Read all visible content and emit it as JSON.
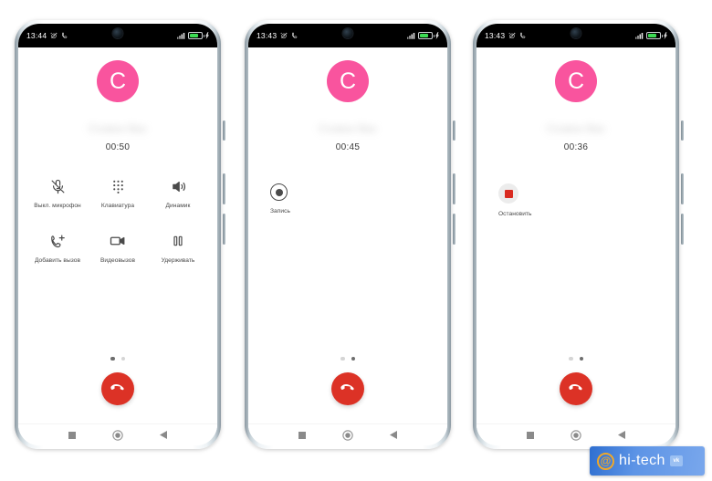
{
  "colors": {
    "avatar_pink": "#f9549e",
    "end_call_red": "#dc3226",
    "stop_square_red": "#d92b21",
    "battery_green": "#3ddc54",
    "watermark_blue": "#5d94e6",
    "watermark_gold": "#f0a829"
  },
  "watermark": {
    "at_symbol": "@",
    "brand": "hi-tech",
    "social_badge": "vk"
  },
  "navbar": {
    "recents_icon": "square-icon",
    "home_icon": "circle-icon",
    "back_icon": "triangle-back-icon"
  },
  "phones": [
    {
      "id": "phone-1",
      "status_bar": {
        "time": "13:44",
        "icons_left": [
          "alarm-off-icon",
          "phone-call-icon"
        ],
        "icons_right": [
          "signal-bars-icon",
          "battery-icon",
          "charging-icon"
        ],
        "battery_level": "78"
      },
      "call": {
        "avatar_letter": "C",
        "contact_name": "Созвон Вас",
        "timer": "00:50",
        "page_dots": 2,
        "active_dot": 1
      },
      "actions": [
        {
          "label": "Выкл. микрофон",
          "icon": "mic-off-icon"
        },
        {
          "label": "Клавиатура",
          "icon": "dialpad-icon"
        },
        {
          "label": "Динамик",
          "icon": "speaker-icon"
        },
        {
          "label": "Добавить вызов",
          "icon": "add-call-icon"
        },
        {
          "label": "Видеовызов",
          "icon": "video-call-icon"
        },
        {
          "label": "Удерживать",
          "icon": "pause-icon"
        }
      ],
      "end_call": {
        "icon": "end-call-icon"
      }
    },
    {
      "id": "phone-2",
      "status_bar": {
        "time": "13:43",
        "icons_left": [
          "alarm-off-icon",
          "phone-call-icon"
        ],
        "icons_right": [
          "signal-bars-icon",
          "battery-icon",
          "charging-icon"
        ],
        "battery_level": "78"
      },
      "call": {
        "avatar_letter": "C",
        "contact_name": "Созвон Вас",
        "timer": "00:45",
        "page_dots": 2,
        "active_dot": 2
      },
      "single_action": {
        "label": "Запись",
        "icon": "record-icon"
      },
      "end_call": {
        "icon": "end-call-icon"
      }
    },
    {
      "id": "phone-3",
      "status_bar": {
        "time": "13:43",
        "icons_left": [
          "alarm-off-icon",
          "phone-call-icon"
        ],
        "icons_right": [
          "signal-bars-icon",
          "battery-icon",
          "charging-icon"
        ],
        "battery_level": "78"
      },
      "call": {
        "avatar_letter": "C",
        "contact_name": "Созвон Вас",
        "timer": "00:36",
        "page_dots": 2,
        "active_dot": 2
      },
      "single_action": {
        "label": "Остановить",
        "icon": "stop-icon"
      },
      "end_call": {
        "icon": "end-call-icon"
      }
    }
  ]
}
